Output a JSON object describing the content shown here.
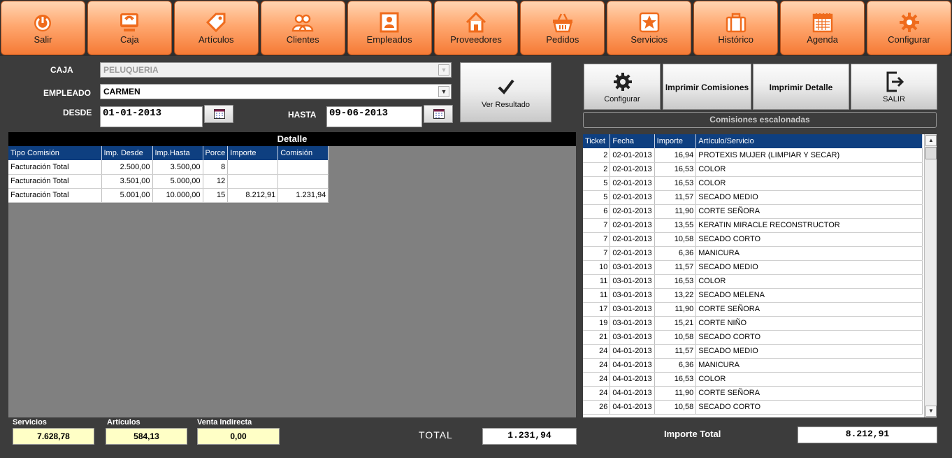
{
  "toolbar": [
    {
      "label": "Salir",
      "icon": "power-icon"
    },
    {
      "label": "Caja",
      "icon": "register-icon"
    },
    {
      "label": "Artículos",
      "icon": "tag-icon"
    },
    {
      "label": "Clientes",
      "icon": "users-icon"
    },
    {
      "label": "Empleados",
      "icon": "employee-icon"
    },
    {
      "label": "Proveedores",
      "icon": "house-icon"
    },
    {
      "label": "Pedidos",
      "icon": "basket-icon"
    },
    {
      "label": "Servicios",
      "icon": "star-icon"
    },
    {
      "label": "Histórico",
      "icon": "briefcase-icon"
    },
    {
      "label": "Agenda",
      "icon": "calendar-icon"
    },
    {
      "label": "Configurar",
      "icon": "gear-icon"
    }
  ],
  "form": {
    "caja_label": "CAJA",
    "caja_value": "PELUQUERIA",
    "empleado_label": "EMPLEADO",
    "empleado_value": "CARMEN",
    "desde_label": "DESDE",
    "desde_value": "01-01-2013",
    "hasta_label": "HASTA",
    "hasta_value": "09-06-2013",
    "ver_resultado": "Ver Resultado"
  },
  "actions": {
    "configurar": "Configurar",
    "imprimir_comisiones": "Imprimir Comisiones",
    "imprimir_detalle": "Imprimir Detalle",
    "salir": "SALIR",
    "comisiones_escalonadas": "Comisiones escalonadas"
  },
  "detalle": {
    "title": "Detalle",
    "columns": [
      "Tipo Comisión",
      "Imp. Desde",
      "Imp.Hasta",
      "Porce",
      "Importe",
      "Comisión"
    ],
    "rows": [
      [
        "Facturación Total",
        "2.500,00",
        "3.500,00",
        "8",
        "",
        ""
      ],
      [
        "Facturación Total",
        "3.501,00",
        "5.000,00",
        "12",
        "",
        ""
      ],
      [
        "Facturación Total",
        "5.001,00",
        "10.000,00",
        "15",
        "8.212,91",
        "1.231,94"
      ]
    ]
  },
  "tickets": {
    "columns": [
      "Ticket",
      "Fecha",
      "Importe",
      "Artículo/Servicio"
    ],
    "rows": [
      [
        "2",
        "02-01-2013",
        "16,94",
        "PROTEXIS MUJER (LIMPIAR Y SECAR)"
      ],
      [
        "2",
        "02-01-2013",
        "16,53",
        "COLOR"
      ],
      [
        "5",
        "02-01-2013",
        "16,53",
        "COLOR"
      ],
      [
        "5",
        "02-01-2013",
        "11,57",
        "SECADO MEDIO"
      ],
      [
        "6",
        "02-01-2013",
        "11,90",
        "CORTE SEÑORA"
      ],
      [
        "7",
        "02-01-2013",
        "13,55",
        "KERATIN MIRACLE RECONSTRUCTOR"
      ],
      [
        "7",
        "02-01-2013",
        "10,58",
        "SECADO CORTO"
      ],
      [
        "7",
        "02-01-2013",
        "6,36",
        "MANICURA"
      ],
      [
        "10",
        "03-01-2013",
        "11,57",
        "SECADO MEDIO"
      ],
      [
        "11",
        "03-01-2013",
        "16,53",
        "COLOR"
      ],
      [
        "11",
        "03-01-2013",
        "13,22",
        "SECADO MELENA"
      ],
      [
        "17",
        "03-01-2013",
        "11,90",
        "CORTE SEÑORA"
      ],
      [
        "19",
        "03-01-2013",
        "15,21",
        "CORTE NIÑO"
      ],
      [
        "21",
        "03-01-2013",
        "10,58",
        "SECADO CORTO"
      ],
      [
        "24",
        "04-01-2013",
        "11,57",
        "SECADO MEDIO"
      ],
      [
        "24",
        "04-01-2013",
        "6,36",
        "MANICURA"
      ],
      [
        "24",
        "04-01-2013",
        "16,53",
        "COLOR"
      ],
      [
        "24",
        "04-01-2013",
        "11,90",
        "CORTE SEÑORA"
      ],
      [
        "26",
        "04-01-2013",
        "10,58",
        "SECADO CORTO"
      ]
    ]
  },
  "footer": {
    "servicios_label": "Servicios",
    "servicios_value": "7.628,78",
    "articulos_label": "Artículos",
    "articulos_value": "584,13",
    "venta_label": "Venta Indirecta",
    "venta_value": "0,00",
    "total_label": "TOTAL",
    "total_value": "1.231,94",
    "importe_total_label": "Importe Total",
    "importe_total_value": "8.212,91"
  },
  "colors": {
    "toolbar_orange": "#f57a35",
    "grid_header": "#0e3f80",
    "background": "#3c3c3c",
    "panel_gray": "#808080",
    "footer_yellow": "#ffffc6"
  }
}
